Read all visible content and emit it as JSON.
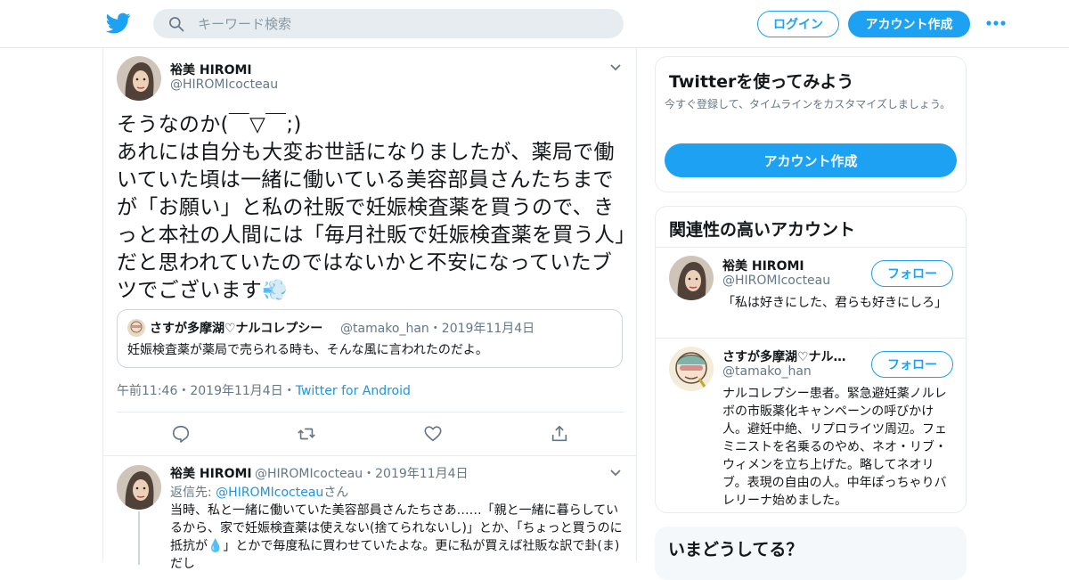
{
  "header": {
    "search_placeholder": "キーワード検索",
    "login_label": "ログイン",
    "signup_label": "アカウント作成",
    "brand_color": "#1da1f2"
  },
  "tweet": {
    "author_name": "裕美 HIROMI",
    "author_handle": "@HIROMIcocteau",
    "text": "そうなのか(￣▽￣;)\nあれには自分も大変お世話になりましたが、薬局で働いていた頃は一緒に働いている美容部員さんたちまでが「お願い」と私の社販で妊娠検査薬を買うので、きっと本社の人間には「毎月社販で妊娠検査薬を買う人」だと思われていたのではないかと不安になっていたブツでございます💨",
    "quote": {
      "name": "さすが多摩湖♡ナルコレプシー",
      "meta": "@tamako_han・2019年11月4日",
      "text": "妊娠検査薬が薬局で売られる時も、そんな風に言われたのだよ。"
    },
    "timestamp": "午前11:46・2019年11月4日・",
    "source": "Twitter for Android"
  },
  "reply": {
    "author_name": "裕美 HIROMI",
    "author_meta": "@HIROMIcocteau・2019年11月4日",
    "reply_to_prefix": "返信先: ",
    "reply_to_mention": "@HIROMIcocteau",
    "reply_to_suffix": "さん",
    "text": "当時、私と一緒に働いていた美容部員さんたちさあ……「親と一緒に暮らしているから、家で妊娠検査薬は使えない(捨てられないし)」とか、「ちょっと買うのに抵抗が💧」とかで毎度私に買わせていたよな。更に私が買えば社販な訳で卦(ま)だし"
  },
  "sidebar": {
    "try_card": {
      "title": "Twitterを使ってみよう",
      "subtitle": "今すぐ登録して、タイムラインをカスタマイズしましょう。",
      "button": "アカウント作成"
    },
    "related": {
      "title": "関連性の高いアカウント",
      "follow_label": "フォロー",
      "accounts": [
        {
          "name": "裕美 HIROMI",
          "handle": "@HIROMIcocteau",
          "bio": "「私は好きにした、君らも好きにしろ」"
        },
        {
          "name": "さすが多摩湖♡ナル…",
          "handle": "@tamako_han",
          "bio": "ナルコレプシー患者。緊急避妊薬ノルレボの市販薬化キャンペーンの呼びかけ人。避妊中絶、リプロライツ周辺。フェミニストを名乗るのやめ、ネオ・リブ・ウィメンを立ち上げた。略してネオリブ。表現の自由の人。中年ぽっちゃりバレリーナ始めました。"
        }
      ]
    },
    "whats_happening": {
      "title": "いまどうしてる？"
    }
  }
}
